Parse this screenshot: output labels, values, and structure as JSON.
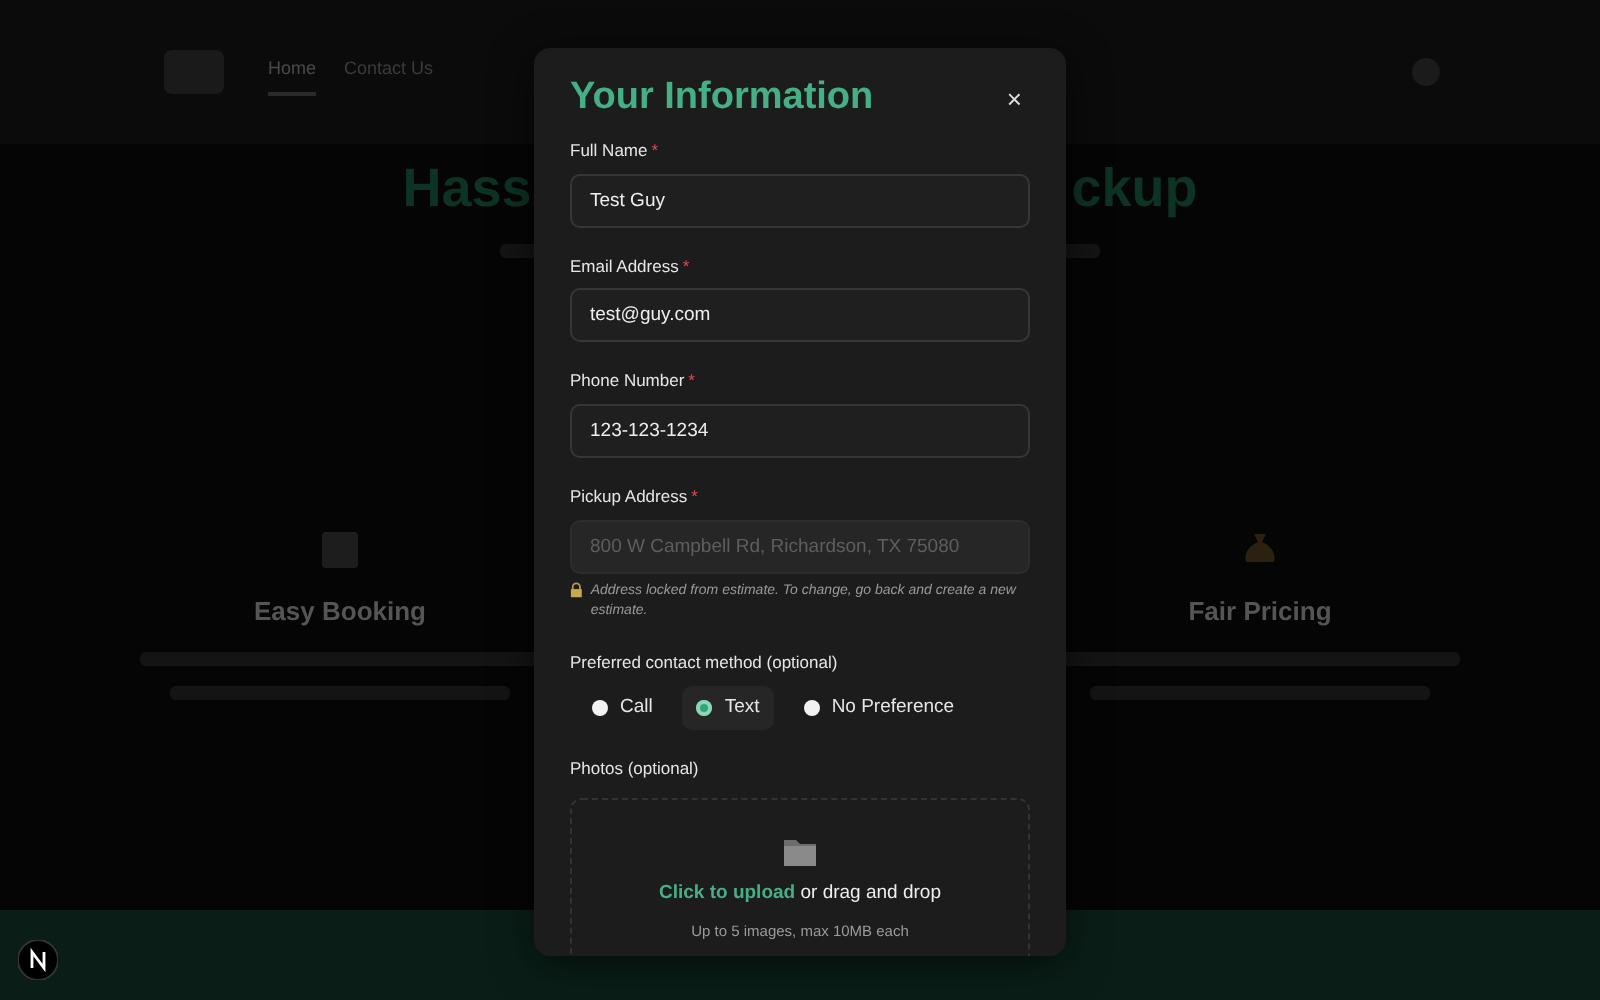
{
  "background": {
    "nav": [
      {
        "label": "Home",
        "selected": true
      },
      {
        "label": "Contact Us",
        "selected": false
      }
    ],
    "hero_title_left": "Hass",
    "hero_title_right": "ckup",
    "features": [
      {
        "title": "Easy Booking"
      },
      {
        "title": "Fair Pricing"
      }
    ]
  },
  "modal": {
    "title": "Your Information",
    "close": "×",
    "fields": [
      {
        "label": "Full Name",
        "marker": "*",
        "value": "Test Guy",
        "disabled": false
      },
      {
        "label": "Email Address",
        "marker": "*",
        "value": "test@guy.com",
        "disabled": false
      },
      {
        "label": "Phone Number",
        "marker": "*",
        "value": "123-123-1234",
        "disabled": false
      },
      {
        "label": "Pickup Address",
        "marker": "*",
        "value": "800 W Campbell Rd, Richardson, TX 75080",
        "disabled": true,
        "note": "Address locked from estimate. To change, go back and create a new estimate."
      }
    ],
    "contact": {
      "label": "Preferred contact method (optional)",
      "options": [
        {
          "label": "Call",
          "selected": false
        },
        {
          "label": "Text",
          "selected": true
        },
        {
          "label": "No Preference",
          "selected": false
        }
      ]
    },
    "photos": {
      "label": "Photos (optional)",
      "upload_link": "Click to upload",
      "upload_text": "or drag and drop",
      "hint": "Up to 5 images, max 10MB each"
    }
  }
}
